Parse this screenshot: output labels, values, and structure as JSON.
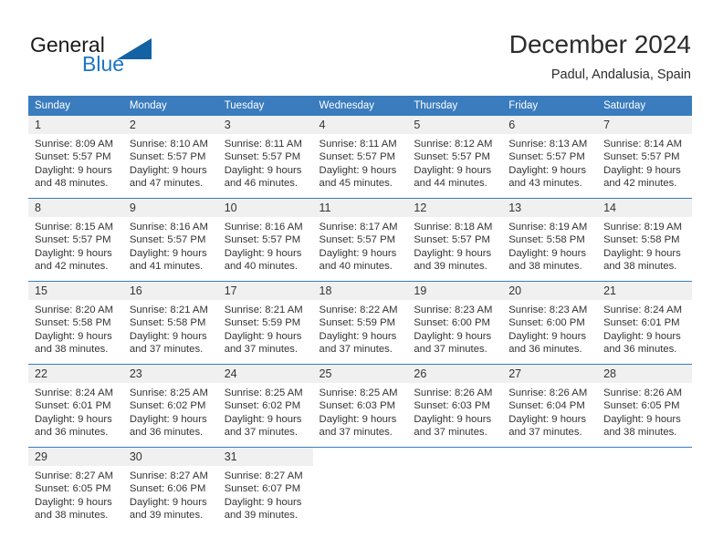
{
  "brand": {
    "name_part1": "General",
    "name_part2": "Blue",
    "accent_color": "#1c76c4",
    "triangle_color": "#1362a4"
  },
  "header": {
    "title": "December 2024",
    "subtitle": "Padul, Andalusia, Spain"
  },
  "calendar": {
    "header_bg": "#3a7cbe",
    "daynum_bg": "#f0f0f0",
    "weekdays": [
      "Sunday",
      "Monday",
      "Tuesday",
      "Wednesday",
      "Thursday",
      "Friday",
      "Saturday"
    ],
    "weeks": [
      [
        {
          "day": "1",
          "sunrise": "Sunrise: 8:09 AM",
          "sunset": "Sunset: 5:57 PM",
          "daylight1": "Daylight: 9 hours",
          "daylight2": "and 48 minutes."
        },
        {
          "day": "2",
          "sunrise": "Sunrise: 8:10 AM",
          "sunset": "Sunset: 5:57 PM",
          "daylight1": "Daylight: 9 hours",
          "daylight2": "and 47 minutes."
        },
        {
          "day": "3",
          "sunrise": "Sunrise: 8:11 AM",
          "sunset": "Sunset: 5:57 PM",
          "daylight1": "Daylight: 9 hours",
          "daylight2": "and 46 minutes."
        },
        {
          "day": "4",
          "sunrise": "Sunrise: 8:11 AM",
          "sunset": "Sunset: 5:57 PM",
          "daylight1": "Daylight: 9 hours",
          "daylight2": "and 45 minutes."
        },
        {
          "day": "5",
          "sunrise": "Sunrise: 8:12 AM",
          "sunset": "Sunset: 5:57 PM",
          "daylight1": "Daylight: 9 hours",
          "daylight2": "and 44 minutes."
        },
        {
          "day": "6",
          "sunrise": "Sunrise: 8:13 AM",
          "sunset": "Sunset: 5:57 PM",
          "daylight1": "Daylight: 9 hours",
          "daylight2": "and 43 minutes."
        },
        {
          "day": "7",
          "sunrise": "Sunrise: 8:14 AM",
          "sunset": "Sunset: 5:57 PM",
          "daylight1": "Daylight: 9 hours",
          "daylight2": "and 42 minutes."
        }
      ],
      [
        {
          "day": "8",
          "sunrise": "Sunrise: 8:15 AM",
          "sunset": "Sunset: 5:57 PM",
          "daylight1": "Daylight: 9 hours",
          "daylight2": "and 42 minutes."
        },
        {
          "day": "9",
          "sunrise": "Sunrise: 8:16 AM",
          "sunset": "Sunset: 5:57 PM",
          "daylight1": "Daylight: 9 hours",
          "daylight2": "and 41 minutes."
        },
        {
          "day": "10",
          "sunrise": "Sunrise: 8:16 AM",
          "sunset": "Sunset: 5:57 PM",
          "daylight1": "Daylight: 9 hours",
          "daylight2": "and 40 minutes."
        },
        {
          "day": "11",
          "sunrise": "Sunrise: 8:17 AM",
          "sunset": "Sunset: 5:57 PM",
          "daylight1": "Daylight: 9 hours",
          "daylight2": "and 40 minutes."
        },
        {
          "day": "12",
          "sunrise": "Sunrise: 8:18 AM",
          "sunset": "Sunset: 5:57 PM",
          "daylight1": "Daylight: 9 hours",
          "daylight2": "and 39 minutes."
        },
        {
          "day": "13",
          "sunrise": "Sunrise: 8:19 AM",
          "sunset": "Sunset: 5:58 PM",
          "daylight1": "Daylight: 9 hours",
          "daylight2": "and 38 minutes."
        },
        {
          "day": "14",
          "sunrise": "Sunrise: 8:19 AM",
          "sunset": "Sunset: 5:58 PM",
          "daylight1": "Daylight: 9 hours",
          "daylight2": "and 38 minutes."
        }
      ],
      [
        {
          "day": "15",
          "sunrise": "Sunrise: 8:20 AM",
          "sunset": "Sunset: 5:58 PM",
          "daylight1": "Daylight: 9 hours",
          "daylight2": "and 38 minutes."
        },
        {
          "day": "16",
          "sunrise": "Sunrise: 8:21 AM",
          "sunset": "Sunset: 5:58 PM",
          "daylight1": "Daylight: 9 hours",
          "daylight2": "and 37 minutes."
        },
        {
          "day": "17",
          "sunrise": "Sunrise: 8:21 AM",
          "sunset": "Sunset: 5:59 PM",
          "daylight1": "Daylight: 9 hours",
          "daylight2": "and 37 minutes."
        },
        {
          "day": "18",
          "sunrise": "Sunrise: 8:22 AM",
          "sunset": "Sunset: 5:59 PM",
          "daylight1": "Daylight: 9 hours",
          "daylight2": "and 37 minutes."
        },
        {
          "day": "19",
          "sunrise": "Sunrise: 8:23 AM",
          "sunset": "Sunset: 6:00 PM",
          "daylight1": "Daylight: 9 hours",
          "daylight2": "and 37 minutes."
        },
        {
          "day": "20",
          "sunrise": "Sunrise: 8:23 AM",
          "sunset": "Sunset: 6:00 PM",
          "daylight1": "Daylight: 9 hours",
          "daylight2": "and 36 minutes."
        },
        {
          "day": "21",
          "sunrise": "Sunrise: 8:24 AM",
          "sunset": "Sunset: 6:01 PM",
          "daylight1": "Daylight: 9 hours",
          "daylight2": "and 36 minutes."
        }
      ],
      [
        {
          "day": "22",
          "sunrise": "Sunrise: 8:24 AM",
          "sunset": "Sunset: 6:01 PM",
          "daylight1": "Daylight: 9 hours",
          "daylight2": "and 36 minutes."
        },
        {
          "day": "23",
          "sunrise": "Sunrise: 8:25 AM",
          "sunset": "Sunset: 6:02 PM",
          "daylight1": "Daylight: 9 hours",
          "daylight2": "and 36 minutes."
        },
        {
          "day": "24",
          "sunrise": "Sunrise: 8:25 AM",
          "sunset": "Sunset: 6:02 PM",
          "daylight1": "Daylight: 9 hours",
          "daylight2": "and 37 minutes."
        },
        {
          "day": "25",
          "sunrise": "Sunrise: 8:25 AM",
          "sunset": "Sunset: 6:03 PM",
          "daylight1": "Daylight: 9 hours",
          "daylight2": "and 37 minutes."
        },
        {
          "day": "26",
          "sunrise": "Sunrise: 8:26 AM",
          "sunset": "Sunset: 6:03 PM",
          "daylight1": "Daylight: 9 hours",
          "daylight2": "and 37 minutes."
        },
        {
          "day": "27",
          "sunrise": "Sunrise: 8:26 AM",
          "sunset": "Sunset: 6:04 PM",
          "daylight1": "Daylight: 9 hours",
          "daylight2": "and 37 minutes."
        },
        {
          "day": "28",
          "sunrise": "Sunrise: 8:26 AM",
          "sunset": "Sunset: 6:05 PM",
          "daylight1": "Daylight: 9 hours",
          "daylight2": "and 38 minutes."
        }
      ],
      [
        {
          "day": "29",
          "sunrise": "Sunrise: 8:27 AM",
          "sunset": "Sunset: 6:05 PM",
          "daylight1": "Daylight: 9 hours",
          "daylight2": "and 38 minutes."
        },
        {
          "day": "30",
          "sunrise": "Sunrise: 8:27 AM",
          "sunset": "Sunset: 6:06 PM",
          "daylight1": "Daylight: 9 hours",
          "daylight2": "and 39 minutes."
        },
        {
          "day": "31",
          "sunrise": "Sunrise: 8:27 AM",
          "sunset": "Sunset: 6:07 PM",
          "daylight1": "Daylight: 9 hours",
          "daylight2": "and 39 minutes."
        },
        {
          "day": "",
          "sunrise": "",
          "sunset": "",
          "daylight1": "",
          "daylight2": ""
        },
        {
          "day": "",
          "sunrise": "",
          "sunset": "",
          "daylight1": "",
          "daylight2": ""
        },
        {
          "day": "",
          "sunrise": "",
          "sunset": "",
          "daylight1": "",
          "daylight2": ""
        },
        {
          "day": "",
          "sunrise": "",
          "sunset": "",
          "daylight1": "",
          "daylight2": ""
        }
      ]
    ]
  }
}
